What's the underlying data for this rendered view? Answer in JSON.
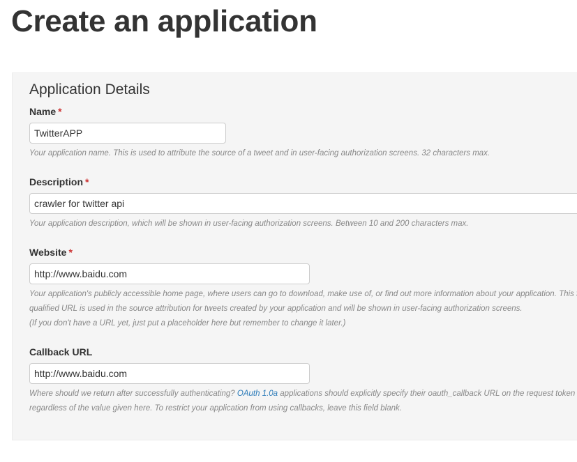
{
  "page": {
    "title": "Create an application"
  },
  "panel": {
    "heading": "Application Details"
  },
  "fields": {
    "name": {
      "label": "Name",
      "required_marker": "*",
      "value": "TwitterAPP",
      "help": "Your application name. This is used to attribute the source of a tweet and in user-facing authorization screens. 32 characters max."
    },
    "description": {
      "label": "Description",
      "required_marker": "*",
      "value": "crawler for twitter api",
      "help": "Your application description, which will be shown in user-facing authorization screens. Between 10 and 200 characters max."
    },
    "website": {
      "label": "Website",
      "required_marker": "*",
      "value": "http://www.baidu.com",
      "help_line1": "Your application's publicly accessible home page, where users can go to download, make use of, or find out more information about your application. This fully-",
      "help_line2": "qualified URL is used in the source attribution for tweets created by your application and will be shown in user-facing authorization screens.",
      "help_line3": "(If you don't have a URL yet, just put a placeholder here but remember to change it later.)"
    },
    "callback_url": {
      "label": "Callback URL",
      "value": "http://www.baidu.com",
      "help_before_link": "Where should we return after successfully authenticating? ",
      "help_link": "OAuth 1.0a",
      "help_after_link": " applications should explicitly specify their oauth_callback URL on the request token step,",
      "help_line2": "regardless of the value given here. To restrict your application from using callbacks, leave this field blank."
    }
  },
  "colors": {
    "required": "#cc3333",
    "link": "#2b7bb9",
    "panel_background": "#f5f5f5"
  }
}
